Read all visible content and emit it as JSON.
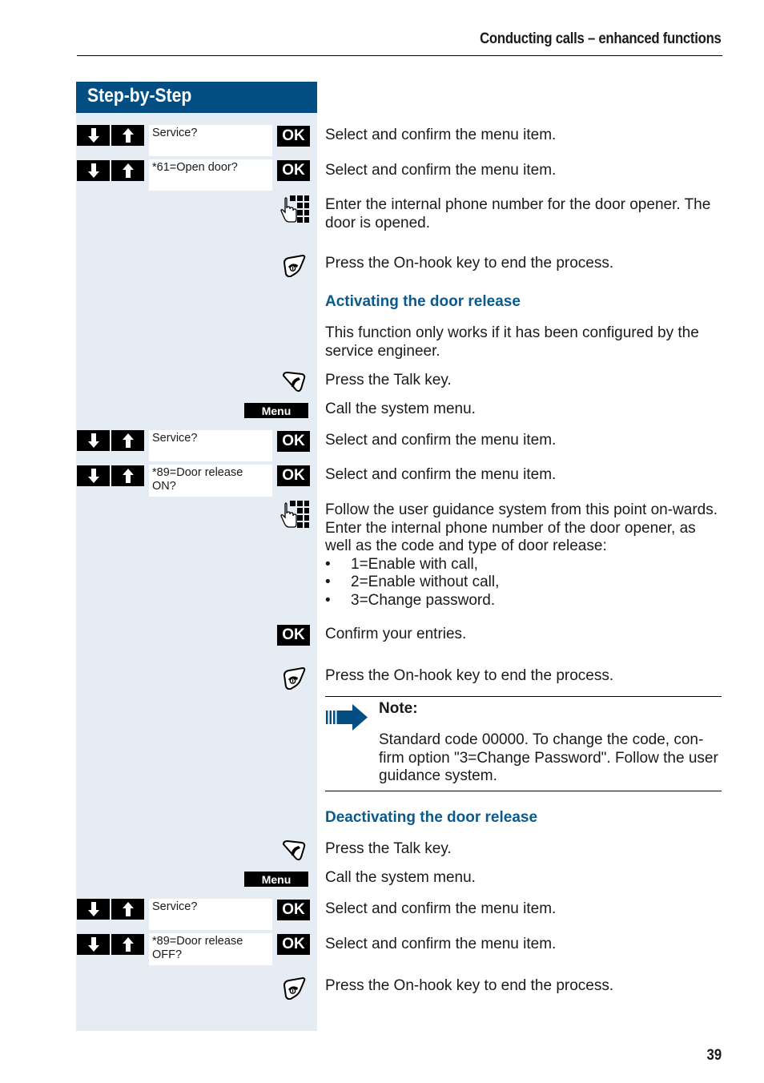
{
  "header": {
    "running_title": "Conducting calls – enhanced functions"
  },
  "sidebar": {
    "title": "Step-by-Step"
  },
  "keys": {
    "ok_label": "OK",
    "menu_label": "Menu"
  },
  "displays": {
    "service": "Service?",
    "open_door": "*61=Open door?",
    "door_release_on": "*89=Door release ON?",
    "door_release_off": "*89=Door release OFF?"
  },
  "steps_open_door": [
    {
      "text": "Select and confirm the menu item."
    },
    {
      "text": "Select and confirm the menu item."
    },
    {
      "text": "Enter the internal phone number for the door opener. The door is opened."
    },
    {
      "text": "Press the On-hook key to end the process."
    }
  ],
  "activating": {
    "heading": "Activating the door release",
    "intro": "This function only works if it has been configured by the service engineer.",
    "steps": [
      {
        "text": "Press the Talk key."
      },
      {
        "text": "Call the system menu."
      },
      {
        "text": "Select and confirm the menu item."
      },
      {
        "text": "Select and confirm the menu item."
      },
      {
        "text": "Follow the user guidance system from this point on-wards. Enter the internal phone number of the door opener, as well as the code and type of door release:"
      },
      {
        "text": "Confirm your entries."
      },
      {
        "text": "Press the On-hook key to end the process."
      }
    ],
    "options": [
      "1=Enable with call,",
      "2=Enable without call,",
      "3=Change password."
    ]
  },
  "note": {
    "label": "Note:",
    "text": "Standard code 00000. To change the code, con-firm option \"3=Change Password\". Follow the user guidance system."
  },
  "deactivating": {
    "heading": "Deactivating the door release",
    "steps": [
      {
        "text": "Press the Talk key."
      },
      {
        "text": "Call the system menu."
      },
      {
        "text": "Select and confirm the menu item."
      },
      {
        "text": "Select and confirm the menu item."
      },
      {
        "text": "Press the On-hook key to end the process."
      }
    ]
  },
  "footer": {
    "page_number": "39"
  },
  "colors": {
    "brand_blue": "#034f84",
    "heading_blue": "#0a5a8a",
    "sidebar_bg": "#e5ecf3"
  }
}
